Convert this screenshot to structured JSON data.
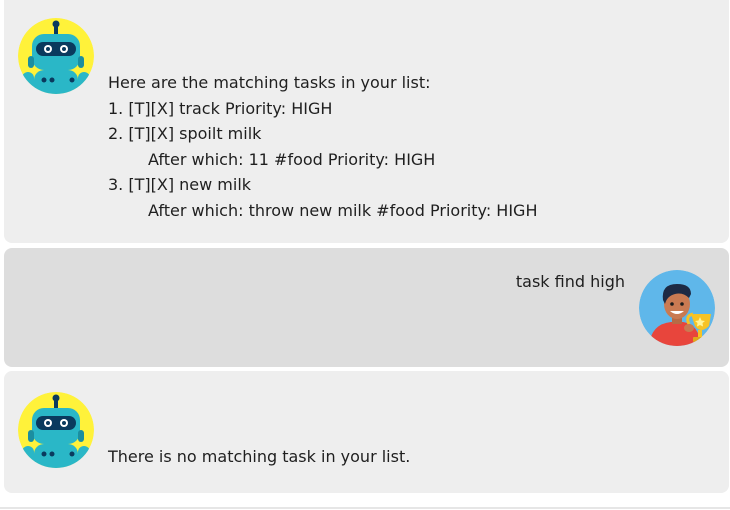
{
  "messages": [
    {
      "sender": "bot",
      "avatar_icon": "robot-icon",
      "lines": [
        "Here are the matching tasks in your list:",
        "1. [T][X] track Priority: HIGH",
        "2. [T][X] spoilt milk",
        "After which: 11 #food Priority: HIGH",
        "3. [T][X] new milk",
        "After which: throw new milk #food Priority: HIGH"
      ]
    },
    {
      "sender": "user",
      "avatar_icon": "user-with-trophy-icon",
      "text": "task find high"
    },
    {
      "sender": "bot",
      "avatar_icon": "robot-icon",
      "text": "There is no matching task in your list."
    }
  ],
  "colors": {
    "bot_bubble": "#eeeeee",
    "user_bubble": "#dddddd",
    "bot_avatar_bg": "#fff23a",
    "user_avatar_bg": "#5fb7ea"
  }
}
